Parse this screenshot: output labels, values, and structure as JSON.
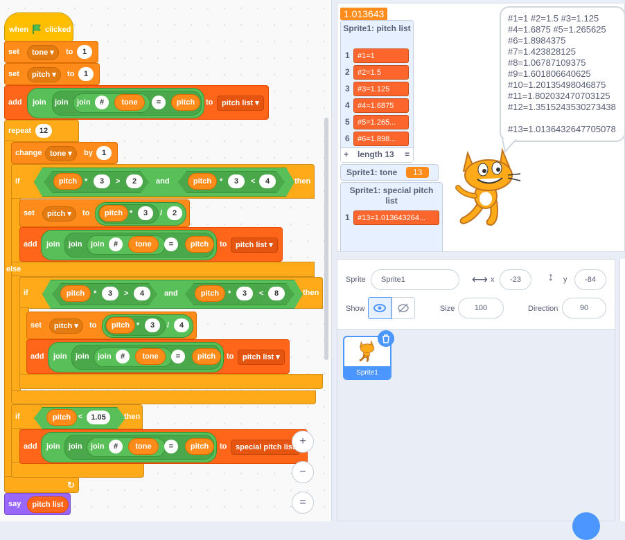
{
  "code": {
    "when_flag": {
      "when": "when",
      "clicked": "clicked"
    },
    "set1": {
      "label": "set",
      "var": "tone ▾",
      "to": "to",
      "value": "1"
    },
    "set2": {
      "label": "set",
      "var": "pitch ▾",
      "to": "to",
      "value": "1"
    },
    "add1": {
      "add": "add",
      "join": "join",
      "hash": "#",
      "tone": "tone",
      "eq": "=",
      "pitch": "pitch",
      "to": "to",
      "list": "pitch list ▾"
    },
    "repeat": {
      "label": "repeat",
      "value": "12"
    },
    "change": {
      "label": "change",
      "var": "tone ▾",
      "by": "by",
      "value": "1"
    },
    "if1": {
      "if": "if",
      "pitch": "pitch",
      "times": "*",
      "three": "3",
      "gt": ">",
      "two": "2",
      "and": "and",
      "pitch2": "pitch",
      "times2": "*",
      "three2": "3",
      "lt": "<",
      "four": "4",
      "then": "then"
    },
    "set3": {
      "label": "set",
      "var": "pitch ▾",
      "to": "to",
      "pitch": "pitch",
      "times": "*",
      "three": "3",
      "div": "/",
      "two": "2"
    },
    "add2": {
      "add": "add",
      "join": "join",
      "hash": "#",
      "tone": "tone",
      "eq": "=",
      "pitch": "pitch",
      "to": "to",
      "list": "pitch list ▾"
    },
    "else": "else",
    "if2": {
      "if": "if",
      "pitch": "pitch",
      "times": "*",
      "three": "3",
      "gt": ">",
      "four": "4",
      "and": "and",
      "pitch2": "pitch",
      "times2": "*",
      "three2": "3",
      "lt": "<",
      "eight": "8",
      "then": "then"
    },
    "set4": {
      "label": "set",
      "var": "pitch ▾",
      "to": "to",
      "pitch": "pitch",
      "times": "*",
      "three": "3",
      "div": "/",
      "four": "4"
    },
    "add3": {
      "add": "add",
      "join": "join",
      "hash": "#",
      "tone": "tone",
      "eq": "=",
      "pitch": "pitch",
      "to": "to",
      "list": "pitch list ▾"
    },
    "if3": {
      "if": "if",
      "pitch": "pitch",
      "lt": "<",
      "value": "1.05",
      "then": "then"
    },
    "add4": {
      "add": "add",
      "join": "join",
      "hash": "#",
      "tone": "tone",
      "eq": "=",
      "pitch": "pitch",
      "to": "to",
      "list": "special pitch list"
    },
    "say": {
      "label": "say",
      "value": "pitch list"
    }
  },
  "zoom": {
    "in": "+",
    "out": "−",
    "reset": "="
  },
  "stage": {
    "top_monitor": "1.013643",
    "pitch_list": {
      "title": "Sprite1: pitch list",
      "items": [
        {
          "i": "1",
          "v": "#1=1"
        },
        {
          "i": "2",
          "v": "#2=1.5"
        },
        {
          "i": "3",
          "v": "#3=1.125"
        },
        {
          "i": "4",
          "v": "#4=1.6875"
        },
        {
          "i": "5",
          "v": "#5=1.265..."
        },
        {
          "i": "6",
          "v": "#6=1.898..."
        }
      ],
      "plus": "+",
      "length": "length 13",
      "eq": "="
    },
    "tone_monitor": {
      "label": "Sprite1: tone",
      "value": "13"
    },
    "special_list": {
      "title": "Sprite1: special pitch list",
      "items": [
        {
          "i": "1",
          "v": "#13=1.013643264..."
        }
      ]
    },
    "bubble": [
      "#1=1 #2=1.5 #3=1.125",
      "#4=1.6875 #5=1.265625",
      "#6=1.8984375",
      "#7=1.423828125",
      "#8=1.06787109375",
      "#9=1.601806640625",
      "#10=1.20135498046875",
      "#11=1.802032470703125",
      "#12=1.3515243530273438",
      "",
      "#13=1.0136432647705078"
    ]
  },
  "sprite_info": {
    "sprite_label": "Sprite",
    "sprite_name": "Sprite1",
    "x_label": "x",
    "x_value": "-23",
    "y_label": "y",
    "y_value": "-84",
    "show_label": "Show",
    "size_label": "Size",
    "size_value": "100",
    "direction_label": "Direction",
    "direction_value": "90"
  },
  "sprite_tile": {
    "name": "Sprite1"
  },
  "colors": {
    "events": "#ffbf00",
    "variables": "#ff8c1a",
    "lists": "#ff661a",
    "control": "#ffab19",
    "operators": "#59c059",
    "looks": "#9966ff",
    "accent": "#4c97ff"
  }
}
